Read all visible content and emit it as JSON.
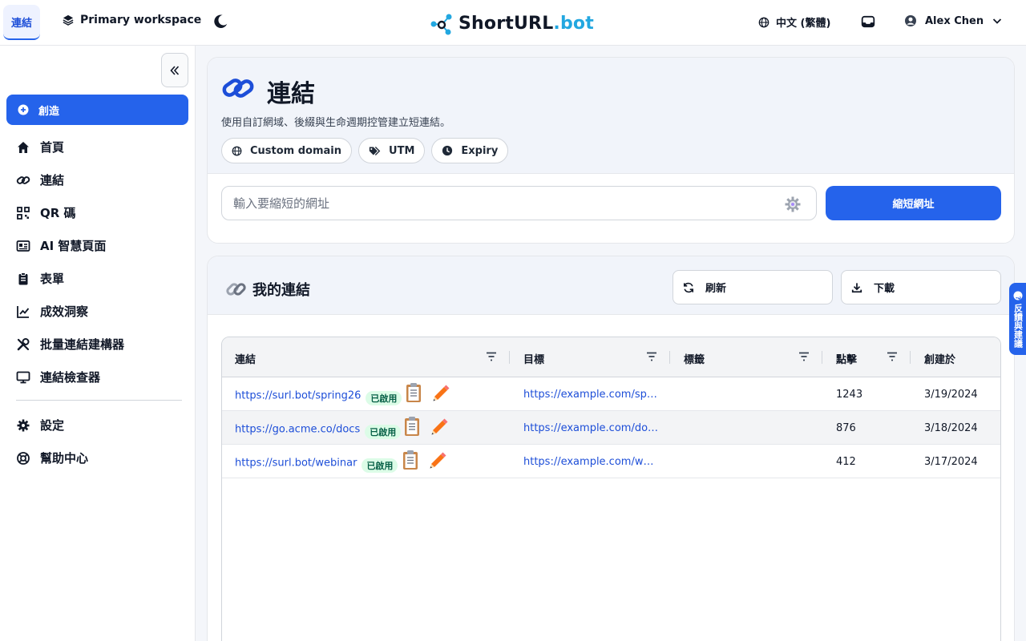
{
  "topbar": {
    "active_tab": "連結",
    "workspace": "Primary workspace",
    "logo_main": "ShortURL",
    "logo_suffix": ".bot",
    "language": "中文 (繁體)",
    "user_name": "Alex Chen"
  },
  "sidebar": {
    "create_label": "創造",
    "items": [
      {
        "label": "首頁",
        "icon": "home-icon"
      },
      {
        "label": "連結",
        "icon": "link-icon"
      },
      {
        "label": "QR 碼",
        "icon": "qr-code-icon"
      },
      {
        "label": "AI 智慧頁面",
        "icon": "id-card-icon"
      },
      {
        "label": "表單",
        "icon": "clipboard-icon"
      },
      {
        "label": "成效洞察",
        "icon": "chart-line-icon"
      },
      {
        "label": "批量連結建構器",
        "icon": "tools-icon"
      },
      {
        "label": "連結檢查器",
        "icon": "monitor-icon"
      }
    ],
    "bottom_items": [
      {
        "label": "設定",
        "icon": "gear-icon"
      },
      {
        "label": "幫助中心",
        "icon": "lifebuoy-icon"
      }
    ]
  },
  "create": {
    "title": "連結",
    "subtitle": "使用自訂網域、後綴與生命週期控管建立短連結。",
    "chips": [
      "Custom domain",
      "UTM",
      "Expiry"
    ],
    "input_placeholder": "輸入要縮短的網址",
    "shorten_label": "縮短網址"
  },
  "links": {
    "title": "我的連結",
    "refresh_label": "刷新",
    "download_label": "下載",
    "columns": [
      "連結",
      "目標",
      "標籤",
      "點擊",
      "創建於"
    ],
    "rows": [
      {
        "short": "https://surl.bot/spring26",
        "status": "已啟用",
        "target": "https://example.com/spring-sale",
        "tags": "",
        "clicks": "1243",
        "created": "3/19/2024"
      },
      {
        "short": "https://go.acme.co/docs",
        "status": "已啟用",
        "target": "https://example.com/docs/getting-started",
        "tags": "",
        "clicks": "876",
        "created": "3/18/2024"
      },
      {
        "short": "https://surl.bot/webinar",
        "status": "已啟用",
        "target": "https://example.com/webinar-registration",
        "tags": "",
        "clicks": "412",
        "created": "3/17/2024"
      }
    ]
  },
  "feedback_label": "反饋與建議",
  "colors": {
    "primary": "#2563eb",
    "logo_accent": "#22a7e0",
    "badge_bg": "#dcfce7",
    "badge_text": "#065f46"
  }
}
